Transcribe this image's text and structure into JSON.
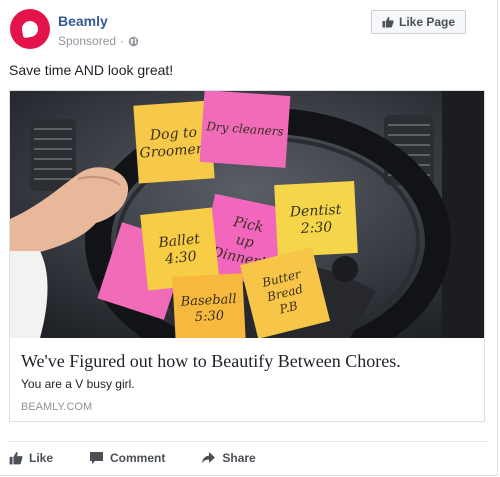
{
  "header": {
    "page_name": "Beamly",
    "sponsored_label": "Sponsored",
    "separator": "·",
    "like_page_label": "Like Page"
  },
  "post": {
    "text": "Save time AND look great!"
  },
  "card": {
    "title": "We've Figured out how to Beautify Between Chores.",
    "description": "You are a V busy girl.",
    "domain": "BEAMLY.COM",
    "notes": [
      {
        "text_lines": [
          "Dog to",
          "Groomers"
        ],
        "color": "#f7c948"
      },
      {
        "text_lines": [
          "Dry cleaners"
        ],
        "color": "#f06bb8"
      },
      {
        "text_lines": [
          "Pick",
          "up",
          "Dinner!!"
        ],
        "color": "#f266be"
      },
      {
        "text_lines": [
          "Dentist",
          "2:30"
        ],
        "color": "#f5d64a"
      },
      {
        "text_lines": [
          "Ballet",
          "4:30"
        ],
        "color": "#f7cd45"
      },
      {
        "text_lines": [
          "Baseball",
          "5:30"
        ],
        "color": "#f6b93e"
      },
      {
        "text_lines": [
          "Butter",
          "Bread",
          "P.B"
        ],
        "color": "#f7c547"
      }
    ]
  },
  "actions": {
    "like_label": "Like",
    "comment_label": "Comment",
    "share_label": "Share"
  },
  "colors": {
    "brand": "#e4134a",
    "link": "#365899",
    "secondary_text": "#90949c",
    "action_text": "#4b4f56"
  }
}
